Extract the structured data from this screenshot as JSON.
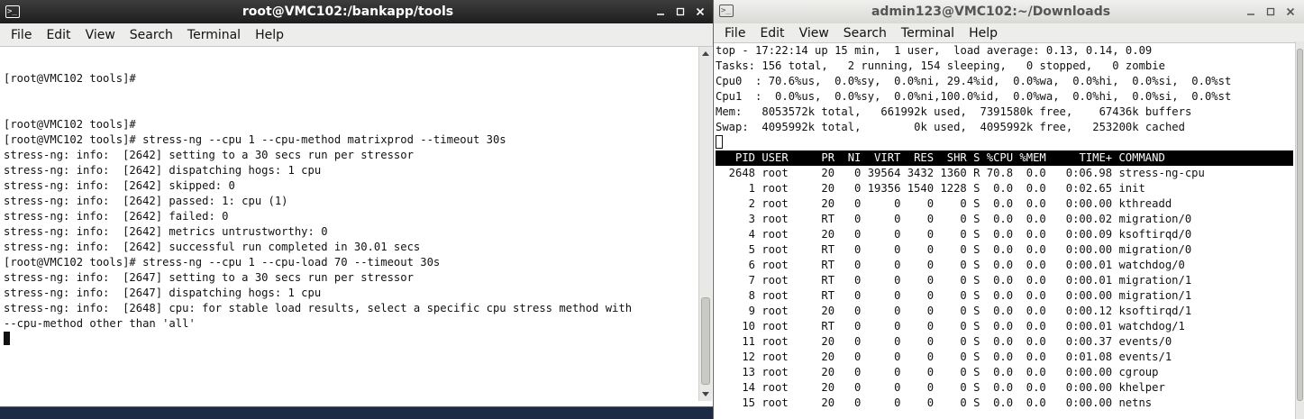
{
  "left_window": {
    "title": "root@VMC102:/bankapp/tools",
    "menu": [
      "File",
      "Edit",
      "View",
      "Search",
      "Terminal",
      "Help"
    ],
    "lines": [
      "",
      "[root@VMC102 tools]#",
      "",
      "",
      "[root@VMC102 tools]#",
      "[root@VMC102 tools]# stress-ng --cpu 1 --cpu-method matrixprod --timeout 30s",
      "stress-ng: info:  [2642] setting to a 30 secs run per stressor",
      "stress-ng: info:  [2642] dispatching hogs: 1 cpu",
      "stress-ng: info:  [2642] skipped: 0",
      "stress-ng: info:  [2642] passed: 1: cpu (1)",
      "stress-ng: info:  [2642] failed: 0",
      "stress-ng: info:  [2642] metrics untrustworthy: 0",
      "stress-ng: info:  [2642] successful run completed in 30.01 secs",
      "[root@VMC102 tools]# stress-ng --cpu 1 --cpu-load 70 --timeout 30s",
      "stress-ng: info:  [2647] setting to a 30 secs run per stressor",
      "stress-ng: info:  [2647] dispatching hogs: 1 cpu",
      "stress-ng: info:  [2648] cpu: for stable load results, select a specific cpu stress method with",
      "--cpu-method other than 'all'"
    ]
  },
  "right_window": {
    "title": "admin123@VMC102:~/Downloads",
    "menu": [
      "File",
      "Edit",
      "View",
      "Search",
      "Terminal",
      "Help"
    ],
    "summary": [
      "top - 17:22:14 up 15 min,  1 user,  load average: 0.13, 0.14, 0.09",
      "Tasks: 156 total,   2 running, 154 sleeping,   0 stopped,   0 zombie",
      "Cpu0  : 70.6%us,  0.0%sy,  0.0%ni, 29.4%id,  0.0%wa,  0.0%hi,  0.0%si,  0.0%st",
      "Cpu1  :  0.0%us,  0.0%sy,  0.0%ni,100.0%id,  0.0%wa,  0.0%hi,  0.0%si,  0.0%st",
      "Mem:   8053572k total,   661992k used,  7391580k free,    67436k buffers",
      "Swap:  4095992k total,        0k used,  4095992k free,   253200k cached"
    ],
    "columns": [
      "PID",
      "USER",
      "PR",
      "NI",
      "VIRT",
      "RES",
      "SHR",
      "S",
      "%CPU",
      "%MEM",
      "TIME+",
      "COMMAND"
    ],
    "processes": [
      [
        "2648",
        "root",
        "20",
        "0",
        "39564",
        "3432",
        "1360",
        "R",
        "70.8",
        "0.0",
        "0:06.98",
        "stress-ng-cpu"
      ],
      [
        "1",
        "root",
        "20",
        "0",
        "19356",
        "1540",
        "1228",
        "S",
        "0.0",
        "0.0",
        "0:02.65",
        "init"
      ],
      [
        "2",
        "root",
        "20",
        "0",
        "0",
        "0",
        "0",
        "S",
        "0.0",
        "0.0",
        "0:00.00",
        "kthreadd"
      ],
      [
        "3",
        "root",
        "RT",
        "0",
        "0",
        "0",
        "0",
        "S",
        "0.0",
        "0.0",
        "0:00.02",
        "migration/0"
      ],
      [
        "4",
        "root",
        "20",
        "0",
        "0",
        "0",
        "0",
        "S",
        "0.0",
        "0.0",
        "0:00.09",
        "ksoftirqd/0"
      ],
      [
        "5",
        "root",
        "RT",
        "0",
        "0",
        "0",
        "0",
        "S",
        "0.0",
        "0.0",
        "0:00.00",
        "migration/0"
      ],
      [
        "6",
        "root",
        "RT",
        "0",
        "0",
        "0",
        "0",
        "S",
        "0.0",
        "0.0",
        "0:00.01",
        "watchdog/0"
      ],
      [
        "7",
        "root",
        "RT",
        "0",
        "0",
        "0",
        "0",
        "S",
        "0.0",
        "0.0",
        "0:00.01",
        "migration/1"
      ],
      [
        "8",
        "root",
        "RT",
        "0",
        "0",
        "0",
        "0",
        "S",
        "0.0",
        "0.0",
        "0:00.00",
        "migration/1"
      ],
      [
        "9",
        "root",
        "20",
        "0",
        "0",
        "0",
        "0",
        "S",
        "0.0",
        "0.0",
        "0:00.12",
        "ksoftirqd/1"
      ],
      [
        "10",
        "root",
        "RT",
        "0",
        "0",
        "0",
        "0",
        "S",
        "0.0",
        "0.0",
        "0:00.01",
        "watchdog/1"
      ],
      [
        "11",
        "root",
        "20",
        "0",
        "0",
        "0",
        "0",
        "S",
        "0.0",
        "0.0",
        "0:00.37",
        "events/0"
      ],
      [
        "12",
        "root",
        "20",
        "0",
        "0",
        "0",
        "0",
        "S",
        "0.0",
        "0.0",
        "0:01.08",
        "events/1"
      ],
      [
        "13",
        "root",
        "20",
        "0",
        "0",
        "0",
        "0",
        "S",
        "0.0",
        "0.0",
        "0:00.00",
        "cgroup"
      ],
      [
        "14",
        "root",
        "20",
        "0",
        "0",
        "0",
        "0",
        "S",
        "0.0",
        "0.0",
        "0:00.00",
        "khelper"
      ],
      [
        "15",
        "root",
        "20",
        "0",
        "0",
        "0",
        "0",
        "S",
        "0.0",
        "0.0",
        "0:00.00",
        "netns"
      ]
    ]
  },
  "icons": {
    "terminal": "terminal-icon",
    "minimize": "minimize-icon",
    "maximize": "maximize-icon",
    "close": "close-icon"
  },
  "colors": {
    "desktop": "#1c2a44",
    "left_titlebar": "#2a2a2a",
    "right_titlebar": "#e4e4e1",
    "top_header_bg": "#000000"
  }
}
